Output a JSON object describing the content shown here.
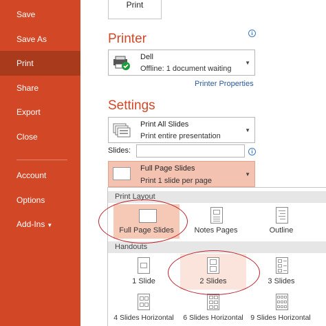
{
  "nav": {
    "items": [
      {
        "label": "Save"
      },
      {
        "label": "Save As"
      },
      {
        "label": "Print"
      },
      {
        "label": "Share"
      },
      {
        "label": "Export"
      },
      {
        "label": "Close"
      },
      {
        "label": "Account"
      },
      {
        "label": "Options"
      },
      {
        "label": "Add-Ins"
      }
    ],
    "active": "Print"
  },
  "print_button": {
    "label": "Print"
  },
  "printer": {
    "title": "Printer",
    "name": "Dell",
    "status": "Offline: 1 document waiting",
    "properties_link": "Printer Properties"
  },
  "settings": {
    "title": "Settings",
    "range": {
      "main": "Print All Slides",
      "sub": "Print entire presentation"
    },
    "slides_label": "Slides:",
    "slides_value": "",
    "layout": {
      "main": "Full Page Slides",
      "sub": "Print 1 slide per page"
    }
  },
  "gallery": {
    "print_layout_header": "Print Layout",
    "handouts_header": "Handouts",
    "layout_options": [
      {
        "label": "Full Page Slides"
      },
      {
        "label": "Notes Pages"
      },
      {
        "label": "Outline"
      }
    ],
    "handout_options": [
      {
        "label": "1 Slide"
      },
      {
        "label": "2 Slides"
      },
      {
        "label": "3 Slides"
      },
      {
        "label": "4 Slides Horizontal"
      },
      {
        "label": "6 Slides Horizontal"
      },
      {
        "label": "9 Slides Horizontal"
      }
    ]
  },
  "colors": {
    "accent": "#d24726",
    "active_nav": "#a93a1c",
    "selection": "#f6c8b6",
    "annotation": "#c0202a"
  }
}
